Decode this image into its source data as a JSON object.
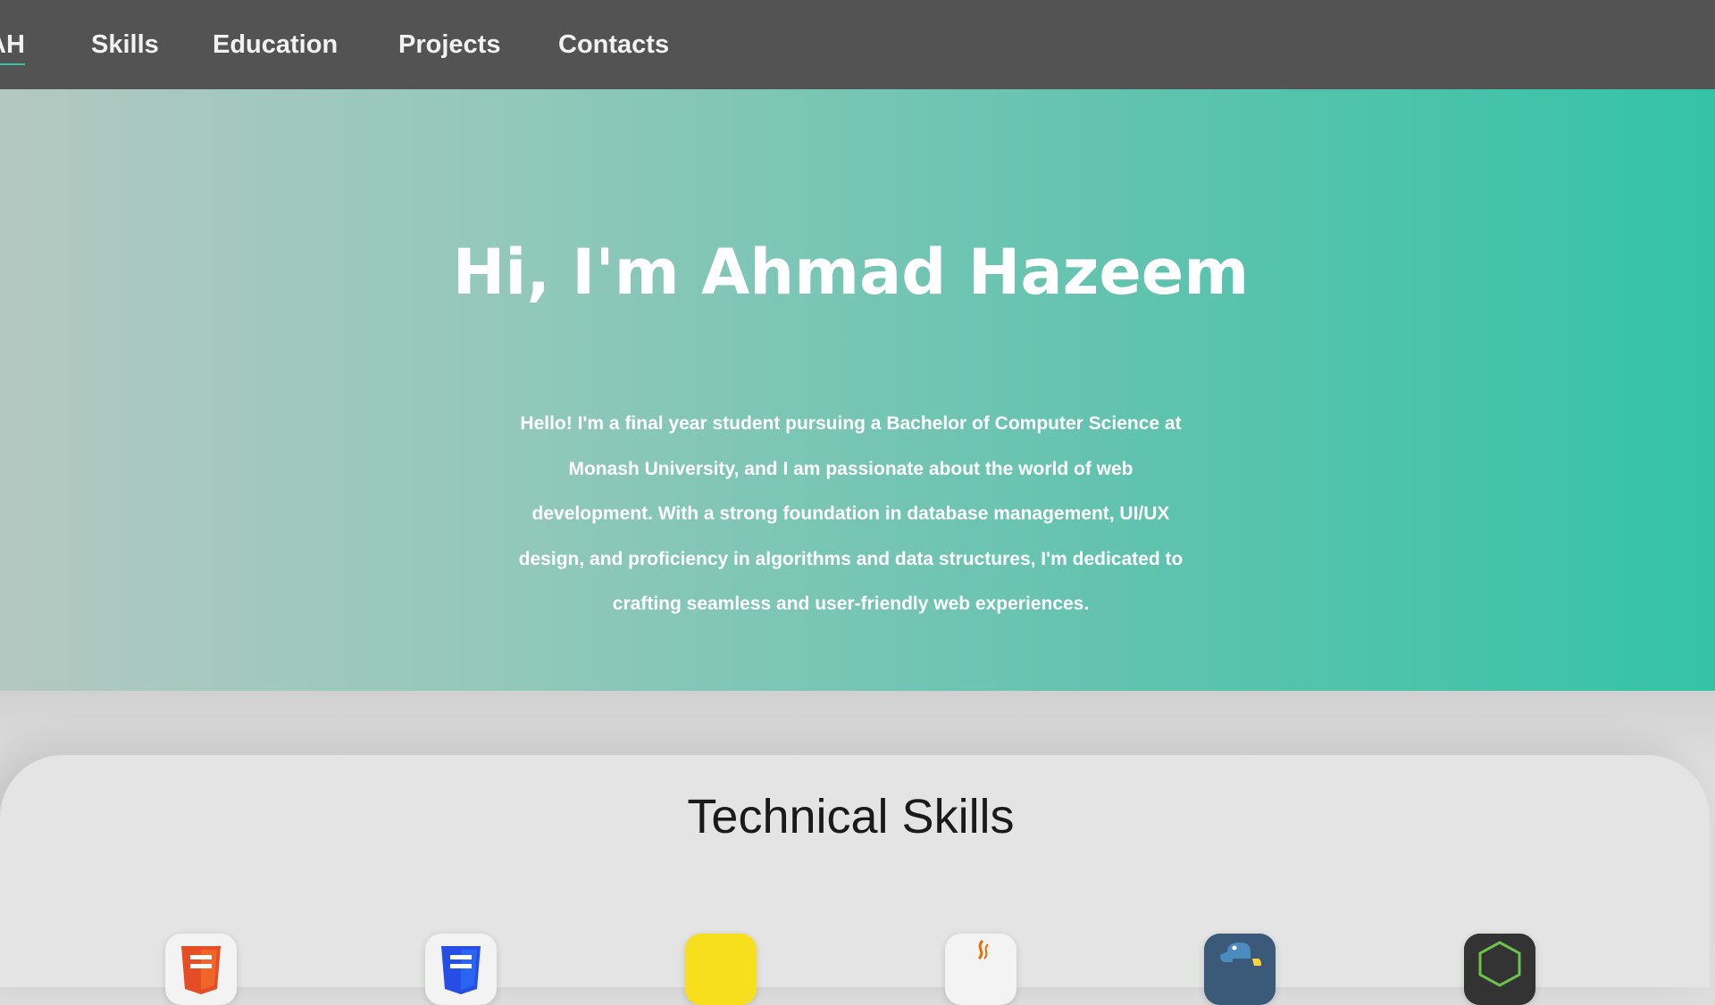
{
  "nav": {
    "logo": "AH",
    "items": [
      "Skills",
      "Education",
      "Projects",
      "Contacts"
    ]
  },
  "hero": {
    "title": "Hi, I'm Ahmad Hazeem",
    "lines": [
      "Hello! I'm a final year student pursuing a Bachelor of Computer Science at",
      "Monash University, and I am passionate about the world of web",
      "development. With a strong foundation in database management, UI/UX",
      "design, and proficiency in algorithms and data structures, I'm dedicated to",
      "crafting seamless and user-friendly web experiences."
    ]
  },
  "skills": {
    "title": "Technical Skills",
    "icons": [
      "html5-icon",
      "css3-icon",
      "javascript-icon",
      "java-icon",
      "python-icon",
      "nodejs-icon"
    ]
  },
  "colors": {
    "navbar": "#535353",
    "accent": "#34c3a6",
    "hero_start": "#b3c8c1",
    "hero_end": "#34c3a6"
  }
}
